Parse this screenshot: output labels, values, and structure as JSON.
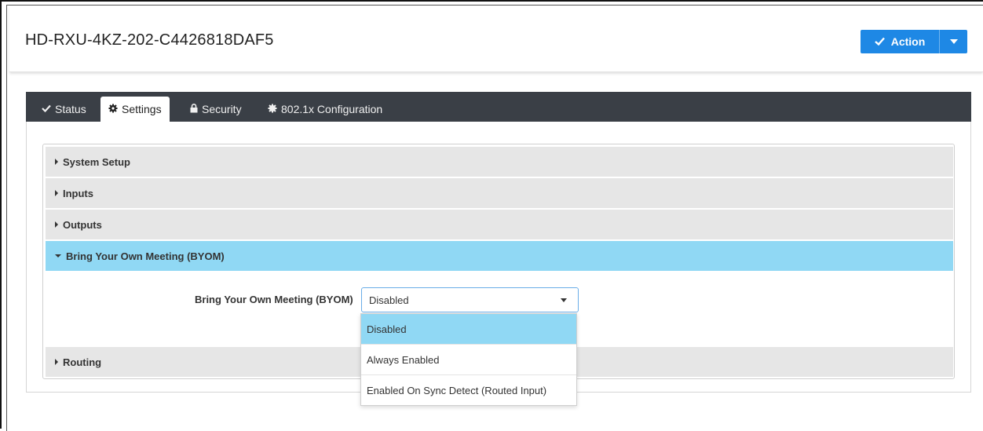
{
  "header": {
    "device_title": "HD-RXU-4KZ-202-C4426818DAF5",
    "action_label": "Action"
  },
  "tabs": [
    {
      "label": "Status",
      "icon": "check-icon",
      "active": false
    },
    {
      "label": "Settings",
      "icon": "gear-icon",
      "active": true
    },
    {
      "label": "Security",
      "icon": "lock-icon",
      "active": false
    },
    {
      "label": "802.1x Configuration",
      "icon": "cog-icon",
      "active": false
    }
  ],
  "accordion": {
    "sections": [
      {
        "label": "System Setup",
        "expanded": false
      },
      {
        "label": "Inputs",
        "expanded": false
      },
      {
        "label": "Outputs",
        "expanded": false
      },
      {
        "label": "Bring Your Own Meeting (BYOM)",
        "expanded": true
      },
      {
        "label": "Routing",
        "expanded": false
      }
    ]
  },
  "byom": {
    "field_label": "Bring Your Own Meeting (BYOM)",
    "selected_value": "Disabled",
    "options": [
      "Disabled",
      "Always Enabled",
      "Enabled On Sync Detect (Routed Input)"
    ]
  },
  "colors": {
    "accent": "#1e88e5",
    "tabbar": "#3a3f46",
    "expanded_section": "#90d8f4",
    "section_bg": "#e6e6e6"
  }
}
